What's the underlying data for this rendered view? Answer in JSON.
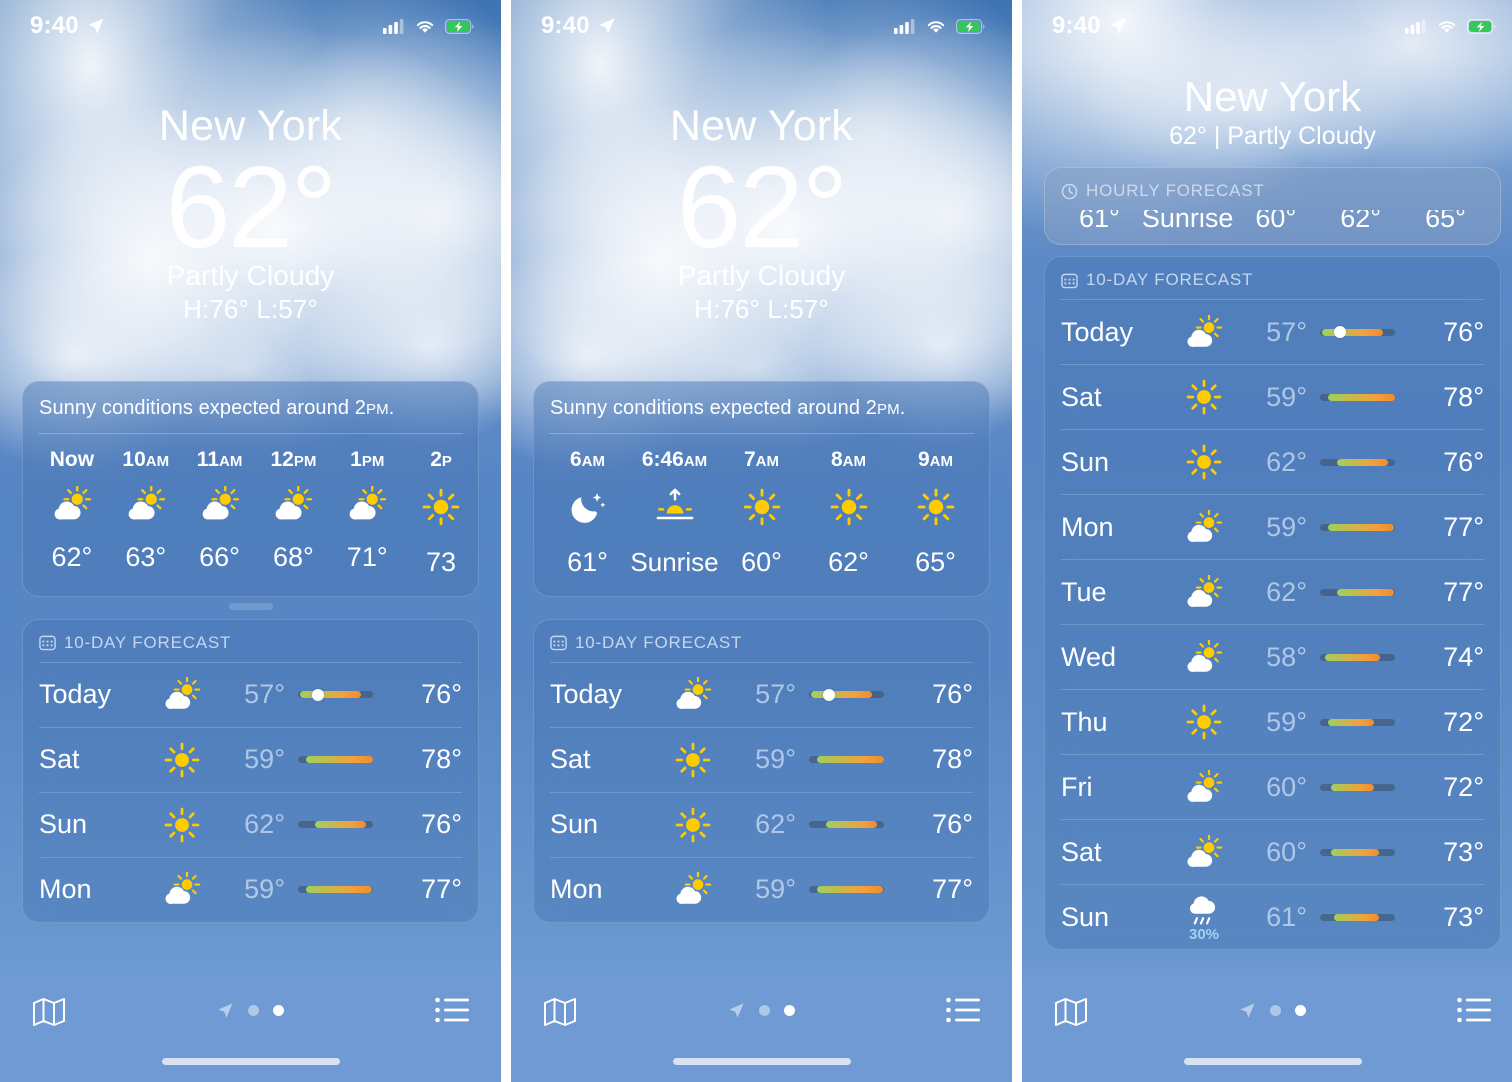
{
  "status_bar": {
    "time": "9:40",
    "location_icon": "location-arrow-icon",
    "cellular_icon": "cellular-signal-icon",
    "wifi_icon": "wifi-icon",
    "battery_icon": "battery-charging-icon",
    "battery_color": "#34C759"
  },
  "tab_bar": {
    "map_icon": "map-icon",
    "list_icon": "list-icon",
    "page_location_icon": "location-arrow-icon",
    "pages": 2,
    "active_page": 2
  },
  "panel1": {
    "hero": {
      "city": "New York",
      "temperature": "62°",
      "condition": "Partly Cloudy",
      "high_low": "H:76°  L:57°"
    },
    "hourly_card": {
      "summary_text": "Sunny conditions expected around ",
      "summary_time": "2",
      "summary_ampm": "PM",
      "summary_suffix": ".",
      "hours": [
        {
          "label": "Now",
          "ampm": "",
          "icon": "partly-cloudy-icon",
          "temp": "62°"
        },
        {
          "label": "10",
          "ampm": "AM",
          "icon": "partly-cloudy-icon",
          "temp": "63°"
        },
        {
          "label": "11",
          "ampm": "AM",
          "icon": "partly-cloudy-icon",
          "temp": "66°"
        },
        {
          "label": "12",
          "ampm": "PM",
          "icon": "partly-cloudy-icon",
          "temp": "68°"
        },
        {
          "label": "1",
          "ampm": "PM",
          "icon": "partly-cloudy-icon",
          "temp": "71°"
        },
        {
          "label": "2",
          "ampm": "P",
          "icon": "sunny-icon",
          "temp": "73"
        }
      ]
    },
    "daily_card": {
      "header": "10-DAY FORECAST",
      "header_icon": "calendar-icon",
      "days": [
        {
          "name": "Today",
          "icon": "partly-cloudy-icon",
          "pop": "",
          "low": "57°",
          "high": "76°",
          "bar_start": 3,
          "bar_end": 84,
          "dot": 26
        },
        {
          "name": "Sat",
          "icon": "sunny-icon",
          "pop": "",
          "low": "59°",
          "high": "78°",
          "bar_start": 10,
          "bar_end": 100,
          "dot": null
        },
        {
          "name": "Sun",
          "icon": "sunny-icon",
          "pop": "",
          "low": "62°",
          "high": "76°",
          "bar_start": 23,
          "bar_end": 90,
          "dot": null
        },
        {
          "name": "Mon",
          "icon": "partly-cloudy-icon",
          "pop": "",
          "low": "59°",
          "high": "77°",
          "bar_start": 10,
          "bar_end": 98,
          "dot": null
        }
      ]
    }
  },
  "panel2": {
    "hero": {
      "city": "New York",
      "temperature": "62°",
      "condition": "Partly Cloudy",
      "high_low": "H:76°  L:57°"
    },
    "hourly_card": {
      "summary_text": "Sunny conditions expected around ",
      "summary_time": "2",
      "summary_ampm": "PM",
      "summary_suffix": ".",
      "hours": [
        {
          "label": "6",
          "ampm": "AM",
          "icon": "moon-stars-icon",
          "temp": "61°"
        },
        {
          "label": "6:46",
          "ampm": "AM",
          "icon": "sunrise-icon",
          "temp": "Sunrise"
        },
        {
          "label": "7",
          "ampm": "AM",
          "icon": "sunny-icon",
          "temp": "60°"
        },
        {
          "label": "8",
          "ampm": "AM",
          "icon": "sunny-icon",
          "temp": "62°"
        },
        {
          "label": "9",
          "ampm": "AM",
          "icon": "sunny-icon",
          "temp": "65°"
        }
      ]
    },
    "daily_card": {
      "header": "10-DAY FORECAST",
      "header_icon": "calendar-icon",
      "days": [
        {
          "name": "Today",
          "icon": "partly-cloudy-icon",
          "pop": "",
          "low": "57°",
          "high": "76°",
          "bar_start": 3,
          "bar_end": 84,
          "dot": 26
        },
        {
          "name": "Sat",
          "icon": "sunny-icon",
          "pop": "",
          "low": "59°",
          "high": "78°",
          "bar_start": 10,
          "bar_end": 100,
          "dot": null
        },
        {
          "name": "Sun",
          "icon": "sunny-icon",
          "pop": "",
          "low": "62°",
          "high": "76°",
          "bar_start": 23,
          "bar_end": 90,
          "dot": null
        },
        {
          "name": "Mon",
          "icon": "partly-cloudy-icon",
          "pop": "",
          "low": "59°",
          "high": "77°",
          "bar_start": 10,
          "bar_end": 98,
          "dot": null
        }
      ]
    }
  },
  "panel3": {
    "hero": {
      "city": "New York",
      "subtitle": "62°  |  Partly Cloudy"
    },
    "hourly_card": {
      "header": "HOURLY FORECAST",
      "header_icon": "clock-icon",
      "clipped_values": [
        "61°",
        "Sunrise",
        "60°",
        "62°",
        "65°"
      ]
    },
    "daily_card": {
      "header": "10-DAY FORECAST",
      "header_icon": "calendar-icon",
      "days": [
        {
          "name": "Today",
          "icon": "partly-cloudy-icon",
          "pop": "",
          "low": "57°",
          "high": "76°",
          "bar_start": 3,
          "bar_end": 84,
          "dot": 26
        },
        {
          "name": "Sat",
          "icon": "sunny-icon",
          "pop": "",
          "low": "59°",
          "high": "78°",
          "bar_start": 10,
          "bar_end": 100,
          "dot": null
        },
        {
          "name": "Sun",
          "icon": "sunny-icon",
          "pop": "",
          "low": "62°",
          "high": "76°",
          "bar_start": 23,
          "bar_end": 90,
          "dot": null
        },
        {
          "name": "Mon",
          "icon": "partly-cloudy-icon",
          "pop": "",
          "low": "59°",
          "high": "77°",
          "bar_start": 10,
          "bar_end": 98,
          "dot": null
        },
        {
          "name": "Tue",
          "icon": "partly-cloudy-icon",
          "pop": "",
          "low": "62°",
          "high": "77°",
          "bar_start": 23,
          "bar_end": 98,
          "dot": null
        },
        {
          "name": "Wed",
          "icon": "partly-cloudy-icon",
          "pop": "",
          "low": "58°",
          "high": "74°",
          "bar_start": 6,
          "bar_end": 80,
          "dot": null
        },
        {
          "name": "Thu",
          "icon": "sunny-icon",
          "pop": "",
          "low": "59°",
          "high": "72°",
          "bar_start": 10,
          "bar_end": 72,
          "dot": null
        },
        {
          "name": "Fri",
          "icon": "partly-cloudy-icon",
          "pop": "",
          "low": "60°",
          "high": "72°",
          "bar_start": 14,
          "bar_end": 72,
          "dot": null
        },
        {
          "name": "Sat",
          "icon": "partly-cloudy-icon",
          "pop": "",
          "low": "60°",
          "high": "73°",
          "bar_start": 14,
          "bar_end": 78,
          "dot": null
        },
        {
          "name": "Sun",
          "icon": "rain-cloud-icon",
          "pop": "30%",
          "low": "61°",
          "high": "73°",
          "bar_start": 19,
          "bar_end": 78,
          "dot": null
        }
      ]
    }
  },
  "colors": {
    "bar_cold": "#9FD05E",
    "bar_warm": "#F2A13A",
    "bar_hot": "#F08C2E",
    "bar_track": "rgba(60,78,102,0.55)",
    "sun_yellow": "#FFCC00",
    "pop_blue": "#9CD4F5",
    "tabbar_blue": "#6F9AD3"
  }
}
